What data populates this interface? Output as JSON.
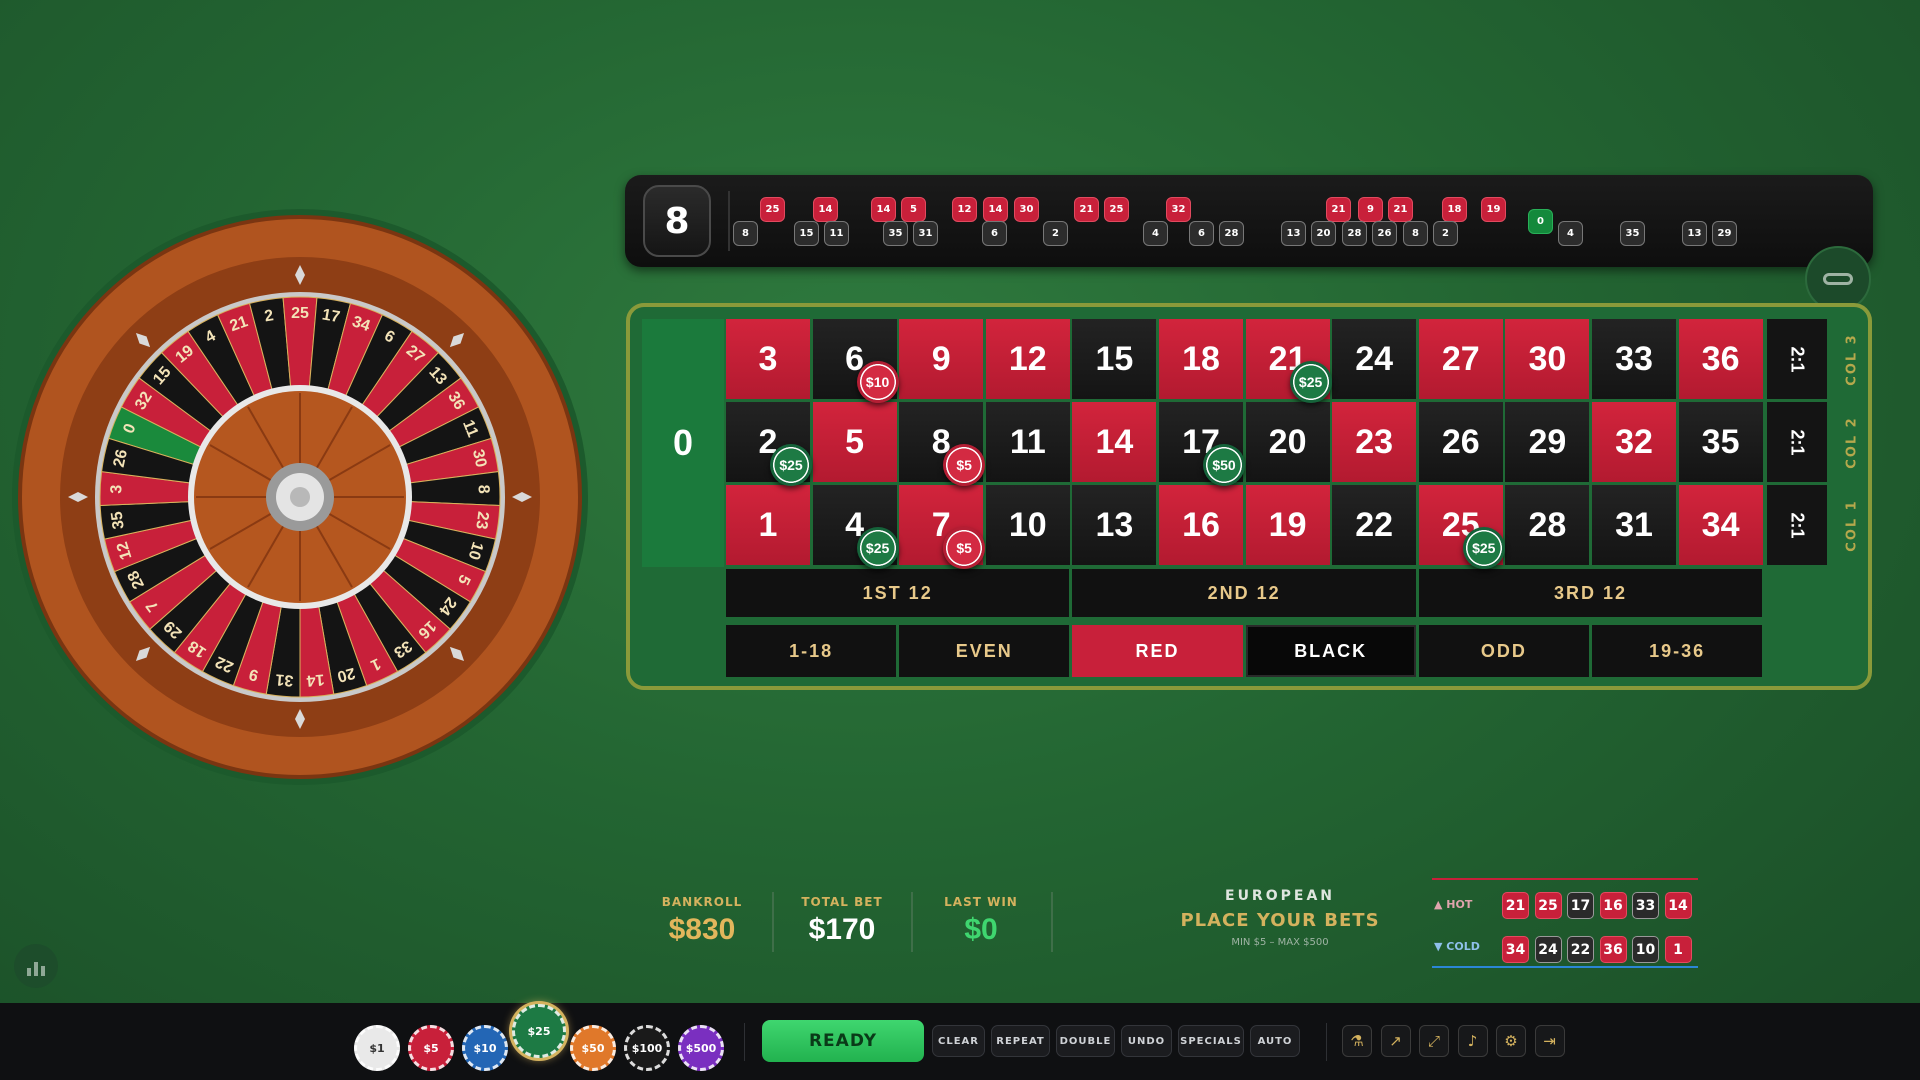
{
  "wheel": {
    "pockets": [
      "0",
      "32",
      "15",
      "19",
      "4",
      "21",
      "2",
      "25",
      "17",
      "34",
      "6",
      "27",
      "13",
      "36",
      "11",
      "30",
      "8",
      "23",
      "10",
      "5",
      "24",
      "16",
      "33",
      "1",
      "20",
      "14",
      "31",
      "9",
      "22",
      "18",
      "29",
      "7",
      "28",
      "12",
      "35",
      "3",
      "26"
    ]
  },
  "history": {
    "last_result": "8",
    "red": [
      {
        "n": "25",
        "x": 15.0
      },
      {
        "n": "14",
        "x": 18.0
      },
      {
        "n": "14",
        "x": 20.9
      },
      {
        "n": "5",
        "x": 22.3
      },
      {
        "n": "12",
        "x": 24.7
      },
      {
        "n": "14",
        "x": 26.4
      },
      {
        "n": "30",
        "x": 28.1
      },
      {
        "n": "21",
        "x": 32.3
      },
      {
        "n": "25",
        "x": 34.0
      },
      {
        "n": "32",
        "x": 39.3
      },
      {
        "n": "21",
        "x": 51.8
      },
      {
        "n": "9",
        "x": 53.5
      },
      {
        "n": "21",
        "x": 55.2
      },
      {
        "n": "18",
        "x": 59.5
      },
      {
        "n": "19",
        "x": 62.6
      }
    ],
    "black": [
      {
        "n": "8",
        "x": 0
      },
      {
        "n": "15",
        "x": 1
      },
      {
        "n": "11",
        "x": 1
      },
      {
        "n": "35",
        "x": 1
      },
      {
        "n": "31",
        "x": 1
      },
      {
        "n": "6",
        "x": 1
      },
      {
        "n": "2",
        "x": 1
      },
      {
        "n": "4",
        "x": 1
      },
      {
        "n": "6",
        "x": 1
      },
      {
        "n": "28",
        "x": 1
      },
      {
        "n": "13",
        "x": 1
      },
      {
        "n": "20",
        "x": 1
      },
      {
        "n": "28",
        "x": 1
      },
      {
        "n": "26",
        "x": 1
      },
      {
        "n": "8",
        "x": 1
      },
      {
        "n": "2",
        "x": 1
      },
      {
        "n": "4",
        "x": 1
      },
      {
        "n": "35",
        "x": 1
      },
      {
        "n": "13",
        "x": 1
      },
      {
        "n": "29",
        "x": 1
      }
    ],
    "green": [
      {
        "n": "0"
      }
    ]
  },
  "table": {
    "zero": "0",
    "rows": [
      [
        {
          "n": "3",
          "c": "red"
        },
        {
          "n": "6",
          "c": "black"
        },
        {
          "n": "9",
          "c": "red"
        },
        {
          "n": "12",
          "c": "red"
        },
        {
          "n": "15",
          "c": "black"
        },
        {
          "n": "18",
          "c": "red"
        },
        {
          "n": "21",
          "c": "red"
        },
        {
          "n": "24",
          "c": "black"
        },
        {
          "n": "27",
          "c": "red"
        },
        {
          "n": "30",
          "c": "red"
        },
        {
          "n": "33",
          "c": "black"
        },
        {
          "n": "36",
          "c": "red"
        }
      ],
      [
        {
          "n": "2",
          "c": "black"
        },
        {
          "n": "5",
          "c": "red"
        },
        {
          "n": "8",
          "c": "black"
        },
        {
          "n": "11",
          "c": "black"
        },
        {
          "n": "14",
          "c": "red"
        },
        {
          "n": "17",
          "c": "black"
        },
        {
          "n": "20",
          "c": "black"
        },
        {
          "n": "23",
          "c": "red"
        },
        {
          "n": "26",
          "c": "black"
        },
        {
          "n": "29",
          "c": "black"
        },
        {
          "n": "32",
          "c": "red"
        },
        {
          "n": "35",
          "c": "black"
        }
      ],
      [
        {
          "n": "1",
          "c": "red"
        },
        {
          "n": "4",
          "c": "black"
        },
        {
          "n": "7",
          "c": "red"
        },
        {
          "n": "10",
          "c": "black"
        },
        {
          "n": "13",
          "c": "black"
        },
        {
          "n": "16",
          "c": "red"
        },
        {
          "n": "19",
          "c": "red"
        },
        {
          "n": "22",
          "c": "black"
        },
        {
          "n": "25",
          "c": "red"
        },
        {
          "n": "28",
          "c": "black"
        },
        {
          "n": "31",
          "c": "black"
        },
        {
          "n": "34",
          "c": "red"
        }
      ]
    ],
    "column_bet_label": "2:1",
    "column_labels": [
      "COL 3",
      "COL 2",
      "COL 1"
    ],
    "dozens": [
      "1ST 12",
      "2ND 12",
      "3RD 12"
    ],
    "outside": [
      "1-18",
      "EVEN",
      "RED",
      "BLACK",
      "ODD",
      "19-36"
    ],
    "placed_chips": [
      {
        "label": "$10",
        "color": "red",
        "row": 0,
        "col": 1
      },
      {
        "label": "$25",
        "color": "green",
        "row": 0,
        "col": 6
      },
      {
        "label": "$25",
        "color": "green",
        "row": 1,
        "col": 0
      },
      {
        "label": "$5",
        "color": "red",
        "row": 1,
        "col": 2
      },
      {
        "label": "$50",
        "color": "green",
        "row": 1,
        "col": 5
      },
      {
        "label": "$25",
        "color": "green",
        "row": 2,
        "col": 1
      },
      {
        "label": "$5",
        "color": "red",
        "row": 2,
        "col": 2
      },
      {
        "label": "$25",
        "color": "green",
        "row": 2,
        "col": 8
      }
    ]
  },
  "stats": {
    "bankroll_label": "BANKROLL",
    "bankroll": "$830",
    "total_bet_label": "TOTAL BET",
    "total_bet": "$170",
    "last_win_label": "LAST WIN",
    "last_win": "$0"
  },
  "status": {
    "variant": "EUROPEAN",
    "message": "PLACE YOUR BETS",
    "limits": "MIN $5 – MAX $500"
  },
  "hot_cold": {
    "hot_label": "▲ HOT",
    "cold_label": "▼ COLD",
    "hot": [
      {
        "n": "21",
        "c": "red"
      },
      {
        "n": "25",
        "c": "red"
      },
      {
        "n": "17",
        "c": "black"
      },
      {
        "n": "16",
        "c": "red"
      },
      {
        "n": "33",
        "c": "black"
      },
      {
        "n": "14",
        "c": "red"
      }
    ],
    "cold": [
      {
        "n": "34",
        "c": "red"
      },
      {
        "n": "24",
        "c": "black"
      },
      {
        "n": "22",
        "c": "black"
      },
      {
        "n": "36",
        "c": "red"
      },
      {
        "n": "10",
        "c": "black"
      },
      {
        "n": "1",
        "c": "red"
      }
    ]
  },
  "chip_selector": [
    {
      "label": "$1",
      "color": "#e9e9e9",
      "text": "#333"
    },
    {
      "label": "$5",
      "color": "#c8203a",
      "text": "#fff"
    },
    {
      "label": "$10",
      "color": "#2366b5",
      "text": "#fff"
    },
    {
      "label": "$25",
      "color": "#1d7a44",
      "text": "#fff",
      "selected": true
    },
    {
      "label": "$50",
      "color": "#e0782a",
      "text": "#fff"
    },
    {
      "label": "$100",
      "color": "#1a1a1a",
      "text": "#fff"
    },
    {
      "label": "$500",
      "color": "#7a2fc0",
      "text": "#fff"
    }
  ],
  "actions": {
    "ready": "READY",
    "buttons": [
      "CLEAR",
      "REPEAT",
      "DOUBLE",
      "UNDO",
      "SPECIALS",
      "AUTO"
    ]
  },
  "tools": [
    "flask-icon",
    "chart-icon",
    "expand-icon",
    "volume-icon",
    "gear-icon",
    "exit-icon"
  ],
  "colors": {
    "red": "#c8203a",
    "black": "#1b1b1b",
    "green": "#1b7a3c",
    "gold": "#d4b25e",
    "felt": "#236532"
  }
}
